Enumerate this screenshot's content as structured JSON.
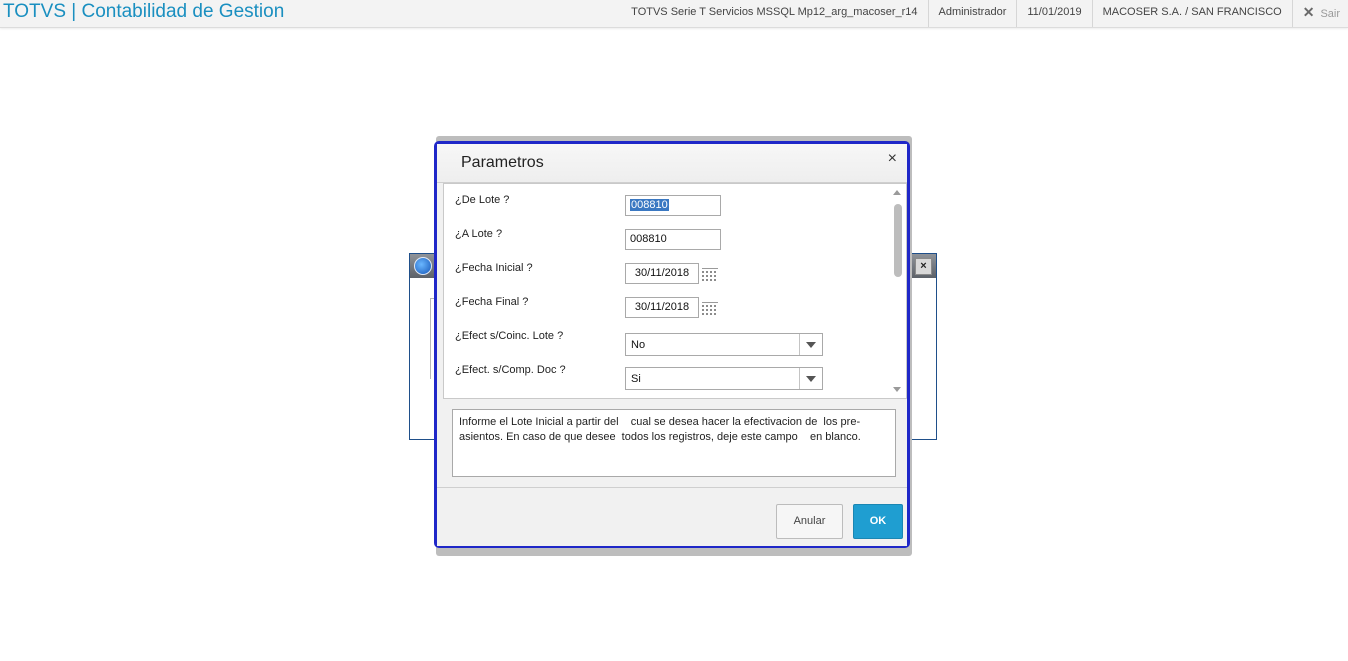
{
  "app": {
    "title": "TOTVS | Contabilidad de Gestion"
  },
  "topbar": {
    "environment": "TOTVS Serie T Servicios MSSQL Mp12_arg_macoser_r14",
    "user": "Administrador",
    "date": "11/01/2019",
    "company": "MACOSER S.A. / SAN FRANCISCO",
    "exit_label": "Sair",
    "exit_icon": "✕"
  },
  "background_window": {
    "close_label": "×"
  },
  "dialog": {
    "title": "Parametros",
    "close_label": "×",
    "fields": {
      "de_lote": {
        "label": "¿De Lote ?",
        "value": "008810"
      },
      "a_lote": {
        "label": "¿A Lote ?",
        "value": "008810"
      },
      "fecha_inicial": {
        "label": "¿Fecha Inicial ?",
        "value": "30/11/2018"
      },
      "fecha_final": {
        "label": "¿Fecha Final ?",
        "value": "30/11/2018"
      },
      "efect_coinc_lote": {
        "label": "¿Efect s/Coinc. Lote ?",
        "value": "No"
      },
      "efect_comp_doc": {
        "label": "¿Efect. s/Comp. Doc ?",
        "value": "Si"
      }
    },
    "help_text": "Informe el Lote Inicial a partir del    cual se desea hacer la efectivacion de  los pre-\nasientos. En caso de que desee  todos los registros, deje este campo    en blanco.",
    "buttons": {
      "cancel": "Anular",
      "ok": "OK"
    }
  },
  "colors": {
    "accent": "#1a8fc0",
    "ok_button": "#1f9ed1",
    "dialog_border": "#1f27c8"
  }
}
